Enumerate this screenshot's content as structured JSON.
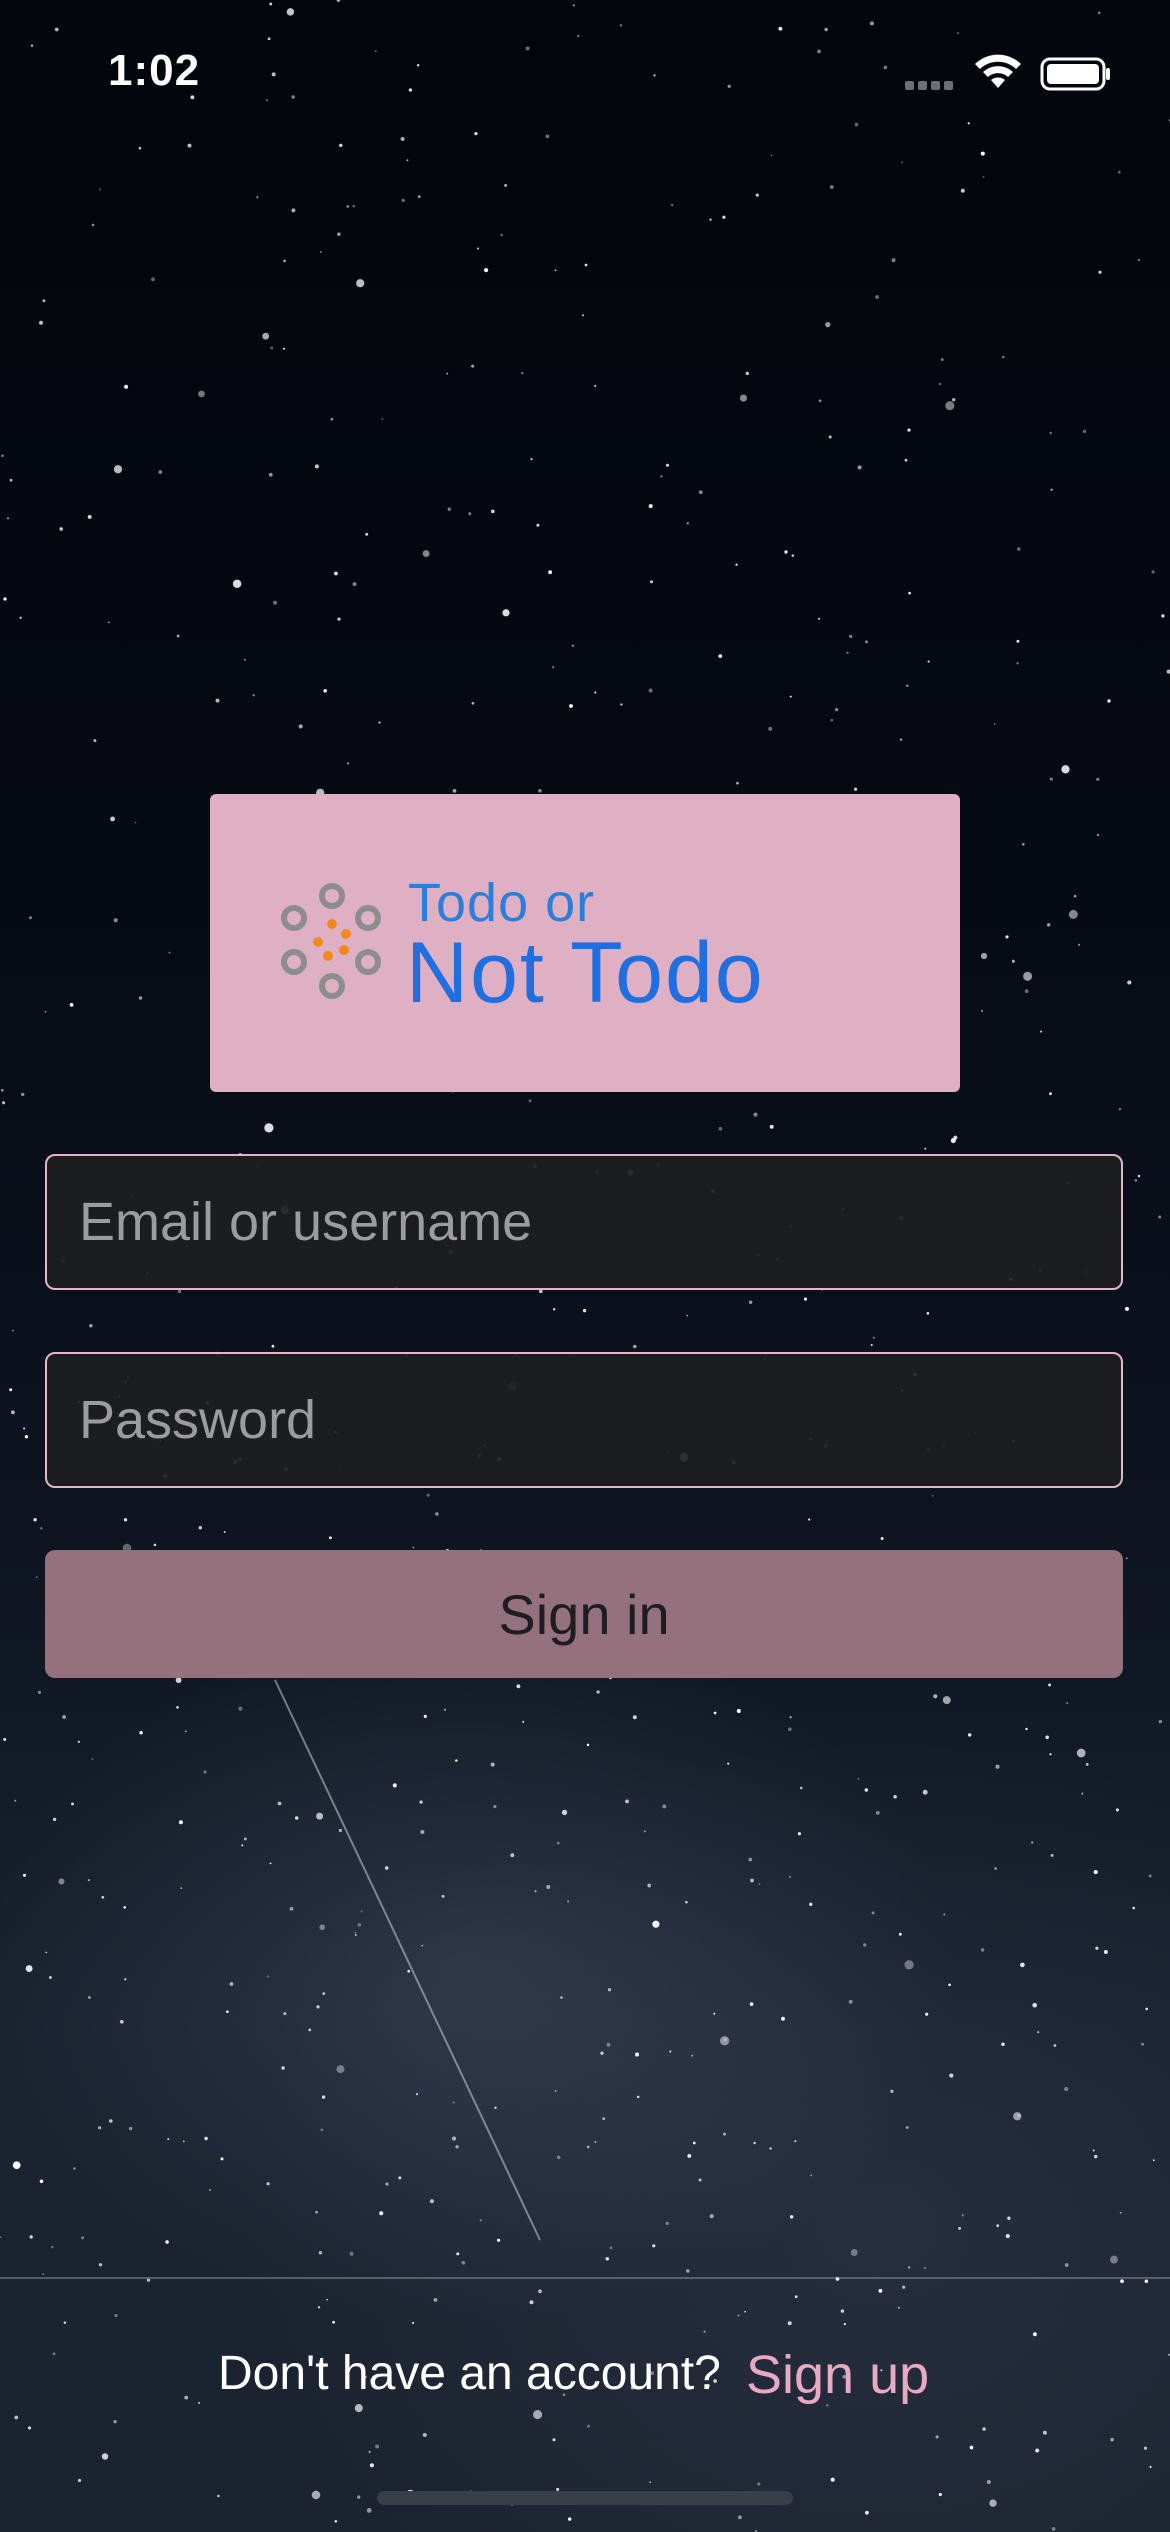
{
  "status_bar": {
    "time": "1:02",
    "signal_icon": "cellular-signal-icon",
    "wifi_icon": "wifi-icon",
    "battery_icon": "battery-icon"
  },
  "logo": {
    "line1": "Todo or",
    "line2": "Not Todo",
    "icon": "dots-cluster-icon",
    "card_color": "#dfb0c4",
    "text_color": "#1f6fe0"
  },
  "login_form": {
    "email_placeholder": "Email or username",
    "email_value": "",
    "password_placeholder": "Password",
    "password_value": "",
    "sign_in_label": "Sign in"
  },
  "footer": {
    "prompt": "Don't have an account?",
    "signup_label": "Sign up"
  },
  "colors": {
    "accent": "#e8a9c2",
    "button": "#94717d",
    "field_border": "#e2b7cb",
    "background": "#04060d"
  }
}
